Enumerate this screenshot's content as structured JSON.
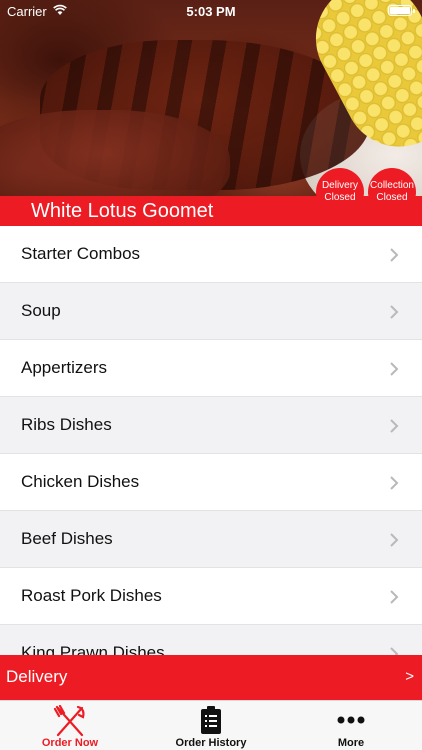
{
  "status_bar": {
    "carrier": "Carrier",
    "time": "5:03 PM"
  },
  "restaurant": {
    "name": "White Lotus Goomet"
  },
  "badges": {
    "delivery": {
      "line1": "Delivery",
      "line2": "Closed"
    },
    "collection": {
      "line1": "Collection",
      "line2": "Closed"
    }
  },
  "menu": {
    "items": [
      {
        "label": "Starter Combos"
      },
      {
        "label": "Soup"
      },
      {
        "label": "Appertizers"
      },
      {
        "label": "Ribs Dishes"
      },
      {
        "label": "Chicken Dishes"
      },
      {
        "label": "Beef Dishes"
      },
      {
        "label": "Roast Pork Dishes"
      },
      {
        "label": "King Prawn Dishes"
      }
    ]
  },
  "delivery_bar": {
    "label": "Delivery",
    "arrow": ">"
  },
  "tab_bar": {
    "tabs": [
      {
        "label": "Order Now",
        "icon": "fork-knife-icon"
      },
      {
        "label": "Order History",
        "icon": "clipboard-icon"
      },
      {
        "label": "More",
        "icon": "more-dots-icon"
      }
    ]
  },
  "colors": {
    "brand_red": "#ed1c24",
    "row_alt": "#f2f2f5",
    "tab_bar_bg": "#f7f7f7"
  }
}
